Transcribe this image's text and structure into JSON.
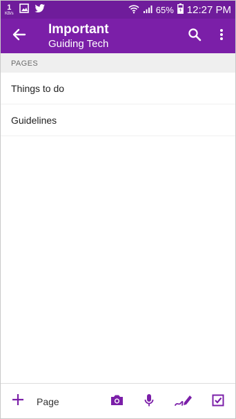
{
  "status_bar": {
    "data_rate": "1",
    "data_rate_unit": "KB/s",
    "battery": "65%",
    "time": "12:27 PM"
  },
  "app_bar": {
    "title": "Important",
    "subtitle": "Guiding Tech"
  },
  "section": {
    "header": "PAGES"
  },
  "pages": [
    {
      "label": "Things to do"
    },
    {
      "label": "Guidelines"
    }
  ],
  "bottom_bar": {
    "add_page_label": "Page"
  },
  "colors": {
    "primary": "#7b1fa8",
    "status_bar": "#6f1c9b",
    "section_bg": "#efefef"
  },
  "icons": [
    "gallery-icon",
    "twitter-icon",
    "wifi-icon",
    "signal-icon",
    "battery-icon",
    "back-arrow-icon",
    "search-icon",
    "more-vert-icon",
    "plus-icon",
    "camera-icon",
    "microphone-icon",
    "pen-icon",
    "checkbox-icon"
  ]
}
